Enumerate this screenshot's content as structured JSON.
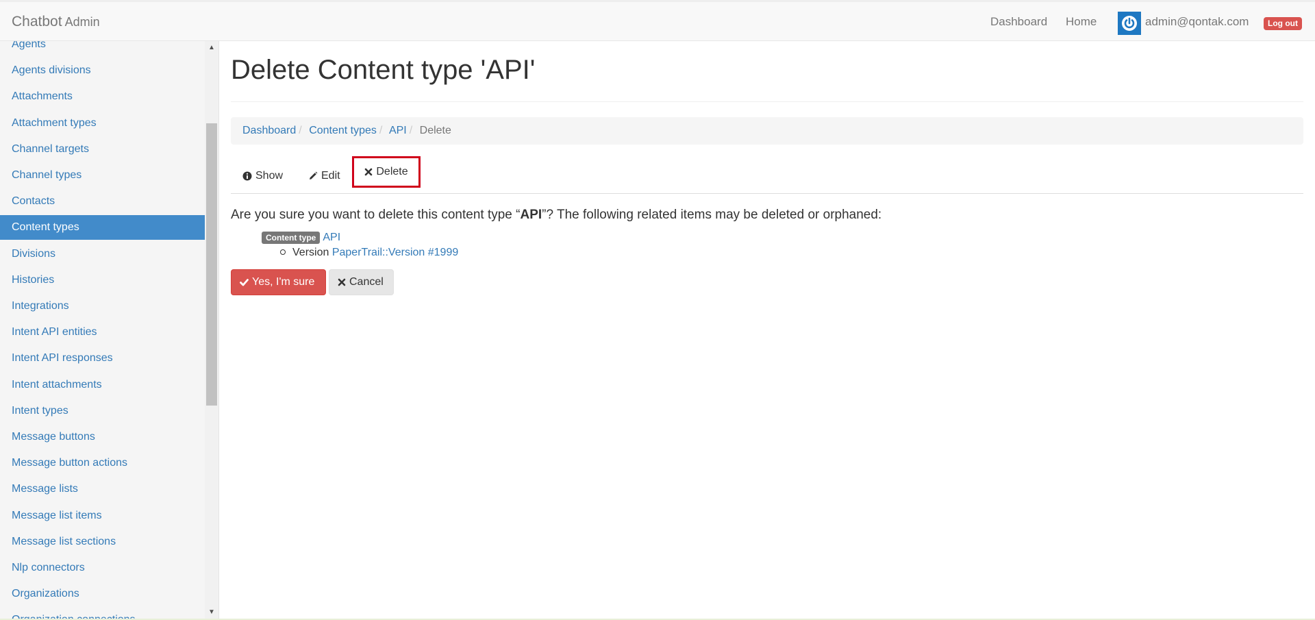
{
  "navbar": {
    "brand": "Chatbot",
    "brand_sub": "Admin",
    "links": {
      "dashboard": "Dashboard",
      "home": "Home"
    },
    "user_email": "admin@qontak.com",
    "logout": "Log out"
  },
  "sidebar": {
    "items": [
      {
        "label": "Agents",
        "active": false
      },
      {
        "label": "Agents divisions",
        "active": false
      },
      {
        "label": "Attachments",
        "active": false
      },
      {
        "label": "Attachment types",
        "active": false
      },
      {
        "label": "Channel targets",
        "active": false
      },
      {
        "label": "Channel types",
        "active": false
      },
      {
        "label": "Contacts",
        "active": false
      },
      {
        "label": "Content types",
        "active": true
      },
      {
        "label": "Divisions",
        "active": false
      },
      {
        "label": "Histories",
        "active": false
      },
      {
        "label": "Integrations",
        "active": false
      },
      {
        "label": "Intent API entities",
        "active": false
      },
      {
        "label": "Intent API responses",
        "active": false
      },
      {
        "label": "Intent attachments",
        "active": false
      },
      {
        "label": "Intent types",
        "active": false
      },
      {
        "label": "Message buttons",
        "active": false
      },
      {
        "label": "Message button actions",
        "active": false
      },
      {
        "label": "Message lists",
        "active": false
      },
      {
        "label": "Message list items",
        "active": false
      },
      {
        "label": "Message list sections",
        "active": false
      },
      {
        "label": "Nlp connectors",
        "active": false
      },
      {
        "label": "Organizations",
        "active": false
      },
      {
        "label": "Organization connections",
        "active": false
      }
    ]
  },
  "main": {
    "title": "Delete Content type 'API'",
    "breadcrumb": {
      "items": [
        "Dashboard",
        "Content types",
        "API"
      ],
      "active": "Delete"
    },
    "tabs": {
      "show": "Show",
      "edit": "Edit",
      "delete": "Delete"
    },
    "confirm": {
      "prefix": "Are you sure you want to delete this content type “",
      "name": "API",
      "suffix": "”? The following related items may be deleted or orphaned:"
    },
    "related": {
      "badge": "Content type",
      "item_link": "API",
      "version_label": "Version",
      "version_link": "PaperTrail::Version #1999"
    },
    "buttons": {
      "yes": "Yes, I'm sure",
      "cancel": "Cancel"
    }
  }
}
